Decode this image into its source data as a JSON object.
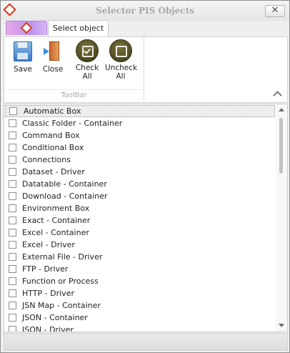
{
  "window": {
    "title": "Selector PIS Objects",
    "close_glyph": "✕"
  },
  "tabs": [
    {
      "label": "Select object"
    }
  ],
  "toolbar": {
    "group_label": "ToolBar",
    "buttons": [
      {
        "label": "Save",
        "icon": "save-icon"
      },
      {
        "label": "Close",
        "icon": "close-door-icon"
      },
      {
        "label": "Check All",
        "label_lines": [
          "Check",
          "All"
        ],
        "icon": "check-all-icon"
      },
      {
        "label": "Uncheck All",
        "label_lines": [
          "Uncheck",
          "All"
        ],
        "icon": "uncheck-all-icon"
      }
    ]
  },
  "objects": [
    {
      "label": "Automatic Box",
      "checked": false
    },
    {
      "label": "Classic Folder - Container",
      "checked": false
    },
    {
      "label": "Command Box",
      "checked": false
    },
    {
      "label": "Conditional Box",
      "checked": false
    },
    {
      "label": "Connections",
      "checked": false
    },
    {
      "label": "Dataset - Driver",
      "checked": false
    },
    {
      "label": "Datatable - Container",
      "checked": false
    },
    {
      "label": "Download - Container",
      "checked": false
    },
    {
      "label": "Environment Box",
      "checked": false
    },
    {
      "label": "Exact - Container",
      "checked": false
    },
    {
      "label": "Excel - Container",
      "checked": false
    },
    {
      "label": "Excel - Driver",
      "checked": false
    },
    {
      "label": "External File - Driver",
      "checked": false
    },
    {
      "label": "FTP - Driver",
      "checked": false
    },
    {
      "label": "Function or Process",
      "checked": false
    },
    {
      "label": "HTTP - Driver",
      "checked": false
    },
    {
      "label": "JSN Map - Container",
      "checked": false
    },
    {
      "label": "JSON - Container",
      "checked": false
    },
    {
      "label": "JSON - Driver",
      "checked": false
    }
  ],
  "colors": {
    "accent": "#d43b1f",
    "tab_gradient": "#b992ec"
  }
}
